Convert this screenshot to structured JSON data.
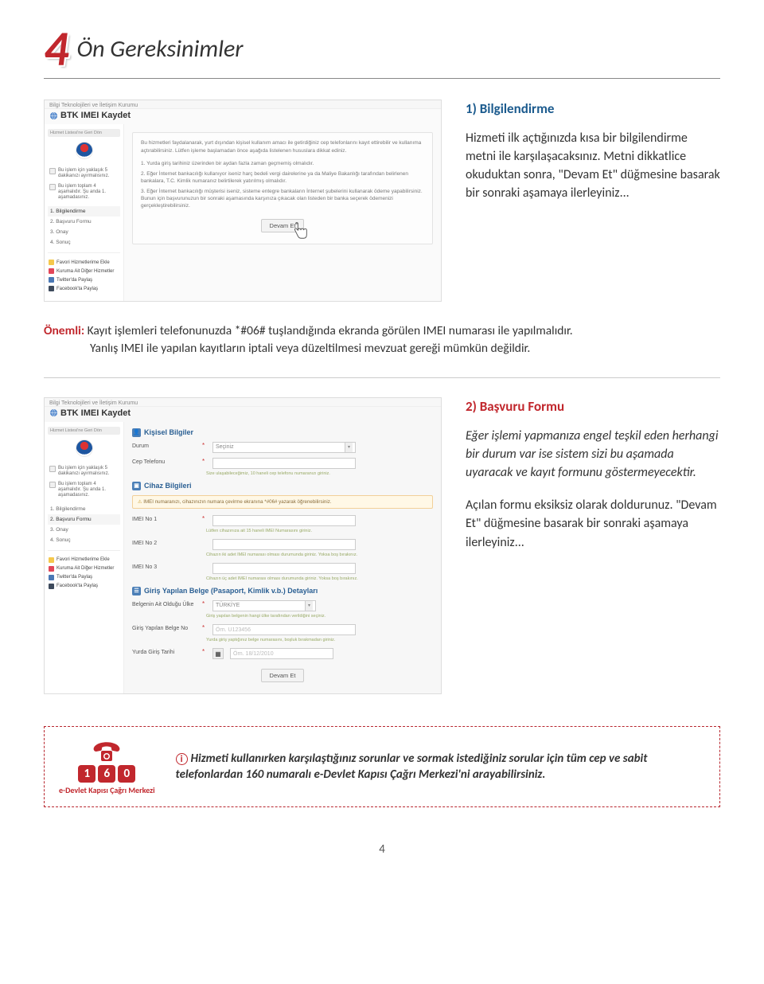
{
  "header": {
    "number": "4",
    "title": "Ön Gereksinimler"
  },
  "step1": {
    "heading": "1) Bilgilendirme",
    "text": "Hizmeti ilk açtığınızda kısa bir bilgilendirme metni ile karşılaşacaksınız. Metni dikkatlice okuduktan sonra, \"Devam Et\" düğmesine basarak bir sonraki aşamaya ilerleyiniz..."
  },
  "important": {
    "label": "Önemli:",
    "line1": " Kayıt işlemleri telefonunuzda *#06# tuşlandığında ekranda görülen IMEI numarası ile yapılmalıdır.",
    "line2": "Yanlış IMEI ile yapılan kayıtların iptali veya düzeltilmesi mevzuat gereği mümkün değildir."
  },
  "screenshot": {
    "org": "Bilgi Teknolojileri ve İletişim Kurumu",
    "appTitle": "BTK IMEI Kaydet",
    "sidebar": {
      "loginTab": "Hizmet Listesi'ne Geri Dön",
      "item1": "Bu işlem için yaklaşık 5 dakikanızı ayırmalısınız.",
      "item2": "Bu işlem toplam 4 aşamalıdır. Şu anda 1. aşamadasınız.",
      "steps": [
        "1.  Bilgilendirme",
        "2.  Başvuru Formu",
        "3.  Onay",
        "4.  Sonuç"
      ],
      "links": [
        "Favori Hizmetlerime Ekle",
        "Kuruma Ait Diğer Hizmetler",
        "Twitter'da Paylaş",
        "Facebook'ta Paylaş"
      ]
    },
    "intro": "Bu hizmetleri faydalanarak, yurt dışından kişisel kullanım amacı ile getirdiğiniz cep telefonlarını kayıt ettirebilir ve kullanıma açtırabilirsiniz. Lütfen işleme başlamadan önce aşağıda listelenen hususlara dikkat ediniz.",
    "lines": [
      "1.   Yurda giriş tarihiniz üzerinden bir aydan fazla zaman geçmemiş olmalıdır.",
      "2.   Eğer İnternet bankacılığı kullanıyor iseniz harç bedeli vergi dairelerine ya da Maliye Bakanlığı tarafından belirlenen bankalara, T.C. Kimlik numaranız belirtilerek yatırılmış olmalıdır.",
      "3.   Eğer İnternet bankacılığı müşterisi iseniz, sisteme entegre bankaların İnternet şubelerini kullanarak ödeme yapabilirsiniz. Bunun için başvurunuzun bir sonraki aşamasında karşınıza çıkacak olan listeden bir banka seçerek ödemenizi gerçekleştirebilirsiniz."
    ],
    "button": "Devam Et"
  },
  "step2": {
    "heading": "2) Başvuru Formu",
    "p1": "Eğer işlemi yapmanıza engel teşkil eden herhangi bir durum var ise sistem sizi bu aşamada uyaracak ve kayıt formunu göstermeyecektir.",
    "p2": "Açılan formu eksiksiz olarak doldurunuz. \"Devam Et\" düğmesine basarak bir sonraki aşamaya ilerleyiniz..."
  },
  "screenshot2": {
    "sections": {
      "kisisel": "Kişisel Bilgiler",
      "cihaz": "Cihaz Bilgileri",
      "belge": "Giriş Yapılan Belge (Pasaport, Kimlik v.b.) Detayları"
    },
    "labels": {
      "durum": "Durum",
      "cep": "Cep Telefonu",
      "imei1": "IMEI No 1",
      "imei2": "IMEI No 2",
      "imei3": "IMEI No 3",
      "ulke": "Belgenin Ait Olduğu Ülke",
      "belgeNo": "Giriş Yapılan Belge No",
      "tarih": "Yurda Giriş Tarihi"
    },
    "values": {
      "sec": "Seçiniz",
      "turkiye": "TÜRKİYE",
      "ornBelge": "Örn. U123456",
      "ornTarih": "Örn. 18/12/2010"
    },
    "helps": {
      "cep": "Size ulaşabileceğimiz, 10 haneli cep telefonu numaranızı giriniz.",
      "imeiWarn": "IMEI numaranızı, cihazınızın numara çevirme ekranına *#06# yazarak öğrenebilirsiniz.",
      "imei1": "Lütfen cihazınıza ait 15 haneli IMEI Numarasını giriniz.",
      "imei2": "Cihazın iki adet IMEI numarası olması durumunda giriniz. Yoksa boş bırakınız.",
      "imei3": "Cihazın üç adet IMEI numarası olması durumunda giriniz. Yoksa boş bırakınız.",
      "ulke": "Giriş yapılan belgenin hangi ülke tarafından verildiğini seçiniz.",
      "belgeNo": "Yurda giriş yaptığınız belge numarasını, boşluk bırakmadan giriniz."
    },
    "button": "Devam Et"
  },
  "callcenter": {
    "digits": [
      "1",
      "6",
      "0"
    ],
    "caption": "e-Devlet Kapısı Çağrı Merkezi",
    "text": "Hizmeti kullanırken karşılaştığınız sorunlar ve sormak istediğiniz sorular için tüm cep ve sabit telefonlardan 160 numaralı e-Devlet Kapısı Çağrı Merkezi'ni arayabilirsiniz."
  },
  "pageNumber": "4"
}
